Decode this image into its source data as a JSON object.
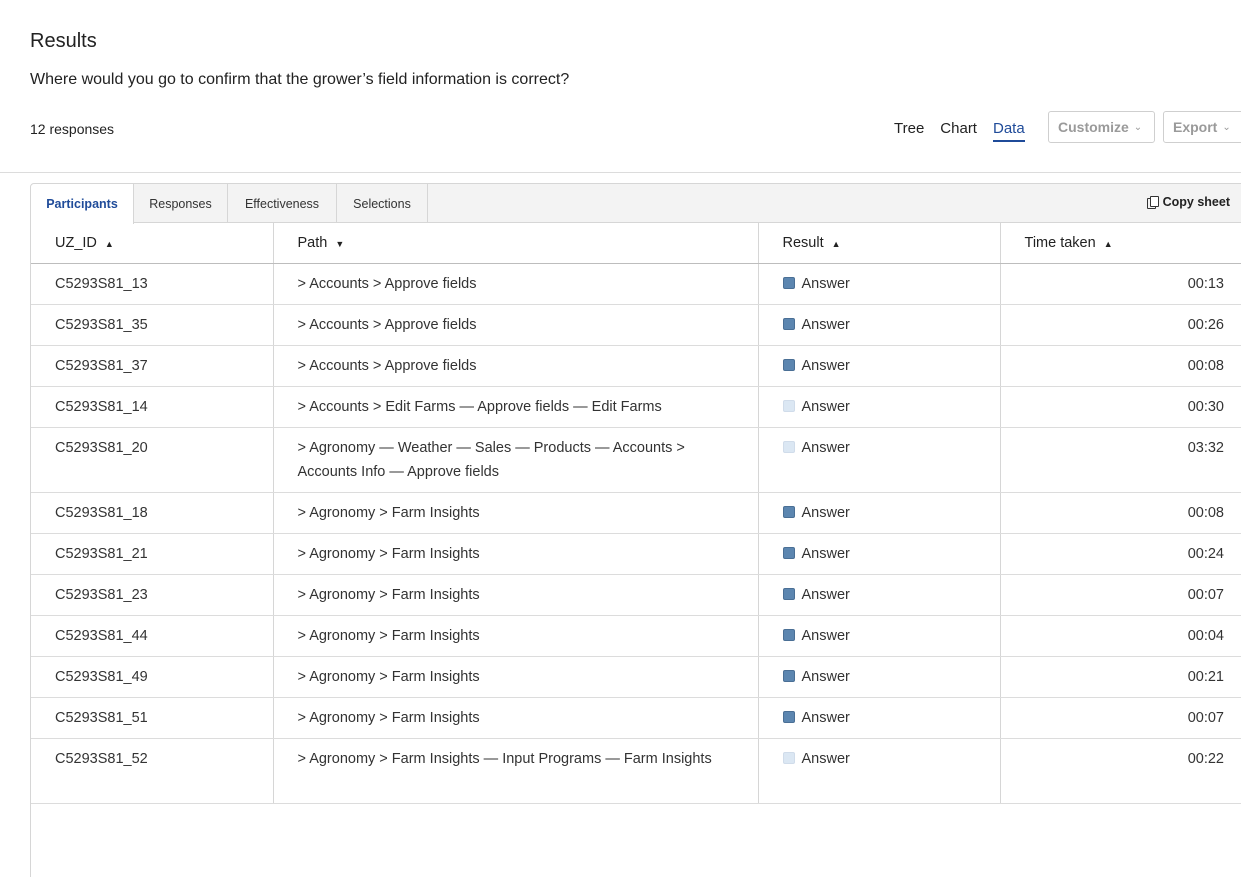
{
  "header": {
    "title": "Results",
    "question": "Where would you go to confirm that the grower’s field information is correct?",
    "responses_count": "12 responses"
  },
  "view_switch": [
    {
      "label": "Tree",
      "active": false
    },
    {
      "label": "Chart",
      "active": false
    },
    {
      "label": "Data",
      "active": true
    }
  ],
  "buttons": {
    "customize": "Customize",
    "export": "Export"
  },
  "tabs": [
    {
      "label": "Participants",
      "active": true
    },
    {
      "label": "Responses",
      "active": false
    },
    {
      "label": "Effectiveness",
      "active": false
    },
    {
      "label": "Selections",
      "active": false
    }
  ],
  "copy_sheet": "Copy sheet",
  "icons": {
    "copy": "copy-icon",
    "sort": "sort-icon",
    "chevron": "chevron-down-icon"
  },
  "colors": {
    "accent": "#1f4b99",
    "result_direct": "#5c86b0",
    "result_indirect": "#dbe7f3"
  },
  "table": {
    "columns": [
      "UZ_ID",
      "Path",
      "Result",
      "Time taken"
    ],
    "rows": [
      {
        "id": "C5293S81_13",
        "path": [
          "Accounts",
          "Approve fields"
        ],
        "path_seps": [
          ">",
          ">"
        ],
        "result": "Answer",
        "direct": true,
        "time": "00:13"
      },
      {
        "id": "C5293S81_35",
        "path": [
          "Accounts",
          "Approve fields"
        ],
        "path_seps": [
          ">",
          ">"
        ],
        "result": "Answer",
        "direct": true,
        "time": "00:26"
      },
      {
        "id": "C5293S81_37",
        "path": [
          "Accounts",
          "Approve fields"
        ],
        "path_seps": [
          ">",
          ">"
        ],
        "result": "Answer",
        "direct": true,
        "time": "00:08"
      },
      {
        "id": "C5293S81_14",
        "path_text": "> Accounts > Edit Farms — Approve fields — Edit Farms",
        "result": "Answer",
        "direct": false,
        "time": "00:30"
      },
      {
        "id": "C5293S81_20",
        "path_text": "> Agronomy — Weather — Sales — Products — Accounts > Accounts Info — Approve fields",
        "result": "Answer",
        "direct": false,
        "time": "03:32",
        "tall": true
      },
      {
        "id": "C5293S81_18",
        "path_text": "> Agronomy > Farm Insights",
        "result": "Answer",
        "direct": true,
        "time": "00:08"
      },
      {
        "id": "C5293S81_21",
        "path_text": "> Agronomy > Farm Insights",
        "result": "Answer",
        "direct": true,
        "time": "00:24"
      },
      {
        "id": "C5293S81_23",
        "path_text": "> Agronomy > Farm Insights",
        "result": "Answer",
        "direct": true,
        "time": "00:07"
      },
      {
        "id": "C5293S81_44",
        "path_text": "> Agronomy > Farm Insights",
        "result": "Answer",
        "direct": true,
        "time": "00:04"
      },
      {
        "id": "C5293S81_49",
        "path_text": "> Agronomy > Farm Insights",
        "result": "Answer",
        "direct": true,
        "time": "00:21"
      },
      {
        "id": "C5293S81_51",
        "path_text": "> Agronomy > Farm Insights",
        "result": "Answer",
        "direct": true,
        "time": "00:07"
      },
      {
        "id": "C5293S81_52",
        "path_text": "> Agronomy > Farm Insights — Input Programs — Farm Insights",
        "result": "Answer",
        "direct": false,
        "time": "00:22",
        "tall": true
      }
    ]
  }
}
